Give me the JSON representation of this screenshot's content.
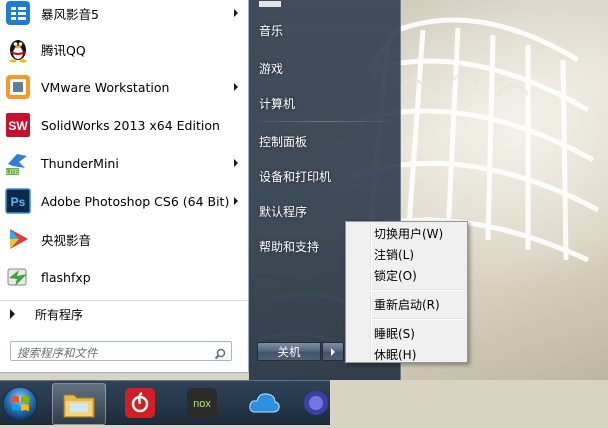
{
  "programs": [
    {
      "label": "暴风影音5",
      "icon": "baofeng-icon",
      "has_submenu": true
    },
    {
      "label": "腾讯QQ",
      "icon": "qq-penguin-icon",
      "has_submenu": false
    },
    {
      "label": "VMware Workstation",
      "icon": "vmware-icon",
      "has_submenu": true
    },
    {
      "label": "SolidWorks 2013 x64 Edition",
      "icon": "solidworks-icon",
      "has_submenu": false
    },
    {
      "label": "ThunderMini",
      "icon": "thunder-bird-icon",
      "has_submenu": true
    },
    {
      "label": "Adobe Photoshop CS6 (64 Bit)",
      "icon": "photoshop-icon",
      "has_submenu": true
    },
    {
      "label": "央视影音",
      "icon": "cctv-player-icon",
      "has_submenu": false
    },
    {
      "label": "flashfxp",
      "icon": "flashfxp-icon",
      "has_submenu": false
    }
  ],
  "all_programs_label": "所有程序",
  "search": {
    "placeholder": "搜索程序和文件",
    "value": ""
  },
  "right_items": [
    {
      "label": "音乐",
      "name": "music"
    },
    {
      "label": "游戏",
      "name": "games"
    },
    {
      "label": "计算机",
      "name": "computer"
    },
    {
      "label": "控制面板",
      "name": "control-panel"
    },
    {
      "label": "设备和打印机",
      "name": "devices-printers"
    },
    {
      "label": "默认程序",
      "name": "default-programs"
    },
    {
      "label": "帮助和支持",
      "name": "help-support"
    }
  ],
  "shutdown_label": "关机",
  "shutdown_menu": {
    "group1": [
      "切换用户(W)",
      "注销(L)",
      "锁定(O)"
    ],
    "group2": [
      "重新启动(R)"
    ],
    "group3": [
      "睡眠(S)",
      "休眠(H)"
    ]
  },
  "taskbar": [
    "windows-start-orb",
    "file-explorer-icon",
    "netease-music-icon",
    "nox-player-icon",
    "cloud-drive-icon",
    "browser-icon"
  ],
  "nox_label": "nox"
}
